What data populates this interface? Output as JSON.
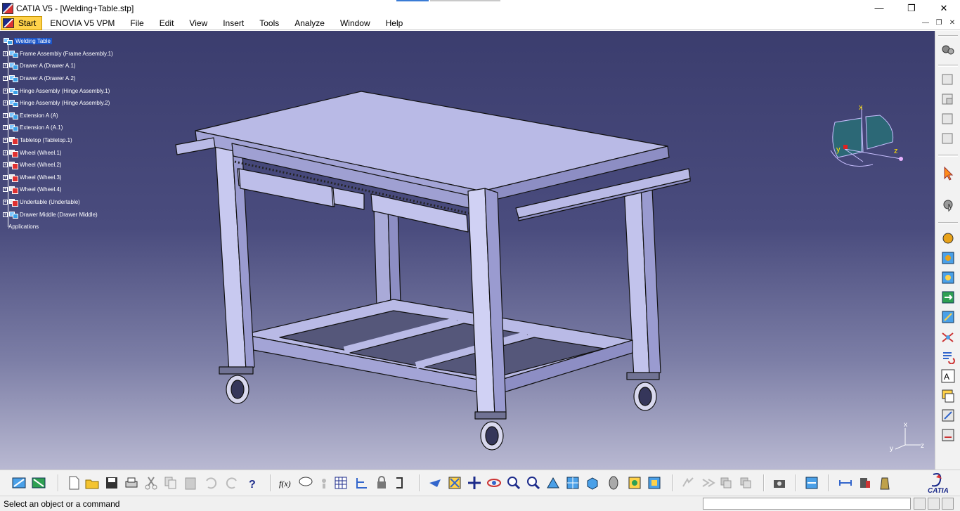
{
  "window": {
    "title": "CATIA V5 - [Welding+Table.stp]",
    "minimize_glyph": "—",
    "maximize_glyph": "❐",
    "close_glyph": "✕",
    "mdi_minimize_glyph": "—",
    "mdi_restore_glyph": "❐",
    "mdi_close_glyph": "✕"
  },
  "menu": {
    "start": "Start",
    "items": [
      "ENOVIA V5 VPM",
      "File",
      "Edit",
      "View",
      "Insert",
      "Tools",
      "Analyze",
      "Window",
      "Help"
    ]
  },
  "tree": {
    "root": "Welding Table",
    "children": [
      {
        "label": "Frame Assembly (Frame Assembly.1)",
        "icon": "assembly-icon"
      },
      {
        "label": "Drawer A (Drawer A.1)",
        "icon": "assembly-icon"
      },
      {
        "label": "Drawer A (Drawer A.2)",
        "icon": "assembly-icon"
      },
      {
        "label": "Hinge Assembly (Hinge Assembly.1)",
        "icon": "assembly-icon"
      },
      {
        "label": "Hinge Assembly (Hinge Assembly.2)",
        "icon": "assembly-icon"
      },
      {
        "label": "Extension A (A)",
        "icon": "assembly-icon"
      },
      {
        "label": "Extension A (A.1)",
        "icon": "assembly-icon"
      },
      {
        "label": "Tabletop (Tabletop.1)",
        "icon": "part-icon"
      },
      {
        "label": "Wheel (Wheel.1)",
        "icon": "part-icon"
      },
      {
        "label": "Wheel (Wheel.2)",
        "icon": "part-icon"
      },
      {
        "label": "Wheel (Wheel.3)",
        "icon": "part-icon"
      },
      {
        "label": "Wheel (Wheel.4)",
        "icon": "part-icon"
      },
      {
        "label": "Undertable (Undertable)",
        "icon": "part-icon"
      },
      {
        "label": "Drawer Middle (Drawer Middle)",
        "icon": "assembly-icon"
      }
    ],
    "applications": "Applications"
  },
  "compass": {
    "x": "x",
    "y": "y",
    "z": "z"
  },
  "axis_triad": {
    "x": "x",
    "y": "y",
    "z": "z"
  },
  "status": {
    "message": "Select an object or a command",
    "command_value": ""
  },
  "colors": {
    "accent": "#3a7bd5",
    "start_bg": "#ffd24a",
    "viewport_top": "#3b3d6e",
    "viewport_bottom": "#b9b9d2",
    "model_fill": "#b9bae6",
    "selection": "#1b55c8"
  },
  "logo": {
    "brand": "CATIA"
  }
}
